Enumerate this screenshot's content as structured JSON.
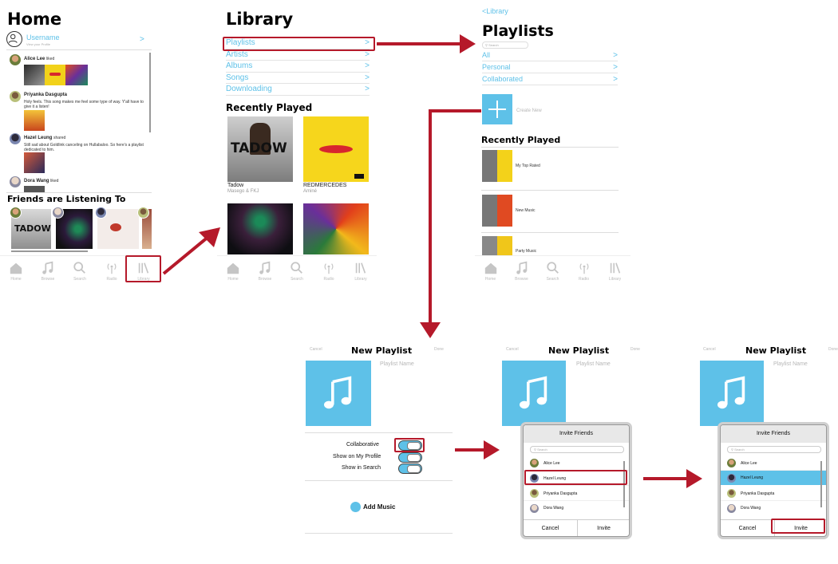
{
  "colors": {
    "accent": "#5ec1e8",
    "highlight": "#b5192a",
    "tab": "#b9b9b9"
  },
  "home": {
    "title": "Home",
    "username": "Username",
    "profile_hint": "View your Profile",
    "feed": [
      {
        "name": "Alice Lee",
        "action": "liked",
        "text": ""
      },
      {
        "name": "Priyanka Dasgupta",
        "action": "",
        "text": "Holy feels. This song makes me feel some type of way. Y'all have to give it a listen!"
      },
      {
        "name": "Hazel Leung",
        "action": "shared",
        "text": "Still sad about Goldlink canceling on Hullabaloo. So here's a playlist dedicated to him."
      },
      {
        "name": "Dora Wang",
        "action": "liked",
        "text": ""
      }
    ],
    "friends_title": "Friends are Listening To",
    "tadow_label": "TADOW"
  },
  "tabs": [
    {
      "label": "Home",
      "icon": "home-icon"
    },
    {
      "label": "Browse",
      "icon": "music-note-icon"
    },
    {
      "label": "Search",
      "icon": "search-icon"
    },
    {
      "label": "Radio",
      "icon": "radio-icon"
    },
    {
      "label": "Library",
      "icon": "library-icon"
    }
  ],
  "library": {
    "title": "Library",
    "items": [
      "Playlists",
      "Artists",
      "Albums",
      "Songs",
      "Downloading"
    ],
    "recent_title": "Recently Played",
    "albums": [
      {
        "title": "Tadow",
        "artist": "Masego & FKJ",
        "cover_text": "TADOW"
      },
      {
        "title": "REDMERCEDES",
        "artist": "Aminé"
      }
    ]
  },
  "playlists": {
    "back": "<Library",
    "title": "Playlists",
    "search_placeholder": "Search",
    "items": [
      "All",
      "Personal",
      "Collaborated"
    ],
    "create": "Create New",
    "recent_title": "Recently Played",
    "recent": [
      "My Top Rated",
      "New Music",
      "Party Music"
    ]
  },
  "new_playlist": {
    "cancel": "Cancel",
    "title": "New Playlist",
    "done": "Done",
    "name_placeholder": "Playlist Name",
    "options": [
      "Collaborative",
      "Show on My Profile",
      "Show in Search"
    ],
    "add_music": "Add Music"
  },
  "invite": {
    "title": "Invite Friends",
    "search_placeholder": "Search",
    "friends": [
      "Alice Lee",
      "Hazel Leung",
      "Priyanka Dasgupta",
      "Dora Wang"
    ],
    "cancel": "Cancel",
    "invite": "Invite"
  },
  "chevron": ">"
}
